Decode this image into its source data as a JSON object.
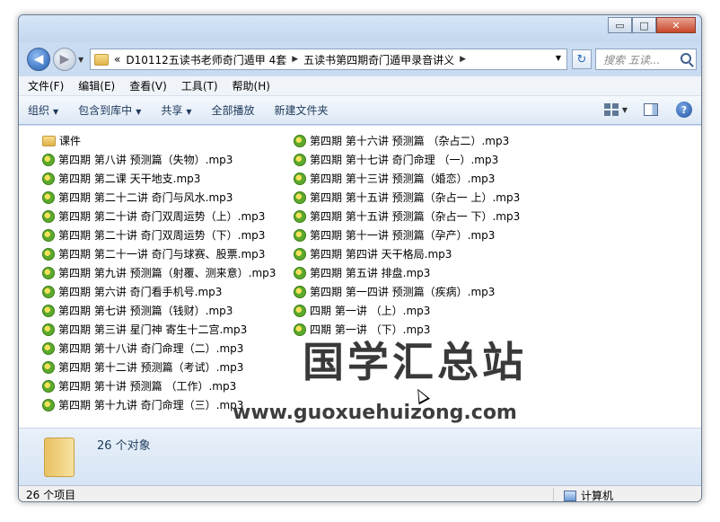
{
  "address": {
    "crumb_root": "«",
    "crumb1": "D10112五读书老师奇门遁甲 4套",
    "crumb2": "五读书第四期奇门遁甲录音讲义",
    "search_placeholder": "搜索 五读..."
  },
  "window": {
    "minimize": "▭",
    "maximize": "□",
    "close": "✕"
  },
  "menu": [
    "文件(F)",
    "编辑(E)",
    "查看(V)",
    "工具(T)",
    "帮助(H)"
  ],
  "toolbar": {
    "organize": "组织",
    "include": "包含到库中",
    "share": "共享",
    "playall": "全部播放",
    "newfolder": "新建文件夹"
  },
  "files_col1": [
    {
      "name": "课件",
      "type": "folder"
    },
    {
      "name": "第四期 第八讲 预测篇（失物）.mp3",
      "type": "mp3"
    },
    {
      "name": "第四期 第二课 天干地支.mp3",
      "type": "mp3"
    },
    {
      "name": "第四期 第二十二讲 奇门与风水.mp3",
      "type": "mp3"
    },
    {
      "name": "第四期 第二十讲 奇门双周运势（上）.mp3",
      "type": "mp3"
    },
    {
      "name": "第四期 第二十讲 奇门双周运势（下）.mp3",
      "type": "mp3"
    },
    {
      "name": "第四期 第二十一讲 奇门与球赛、股票.mp3",
      "type": "mp3"
    },
    {
      "name": "第四期 第九讲 预测篇（射覆、测来意）.mp3",
      "type": "mp3"
    },
    {
      "name": "第四期 第六讲 奇门看手机号.mp3",
      "type": "mp3"
    },
    {
      "name": "第四期 第七讲 预测篇（钱财）.mp3",
      "type": "mp3"
    },
    {
      "name": "第四期 第三讲 星门神 寄生十二宫.mp3",
      "type": "mp3"
    },
    {
      "name": "第四期 第十八讲 奇门命理（二）.mp3",
      "type": "mp3"
    },
    {
      "name": "第四期 第十二讲 预测篇（考试）.mp3",
      "type": "mp3"
    },
    {
      "name": "第四期 第十讲 预测篇 （工作）.mp3",
      "type": "mp3"
    },
    {
      "name": "第四期 第十九讲 奇门命理（三）.mp3",
      "type": "mp3"
    }
  ],
  "files_col2": [
    {
      "name": "第四期 第十六讲 预测篇 （杂占二）.mp3",
      "type": "mp3"
    },
    {
      "name": "第四期 第十七讲 奇门命理 （一）.mp3",
      "type": "mp3"
    },
    {
      "name": "第四期 第十三讲 预测篇（婚恋）.mp3",
      "type": "mp3"
    },
    {
      "name": "第四期 第十五讲 预测篇（杂占一 上）.mp3",
      "type": "mp3"
    },
    {
      "name": "第四期 第十五讲 预测篇（杂占一 下）.mp3",
      "type": "mp3"
    },
    {
      "name": "第四期 第十一讲 预测篇（孕产）.mp3",
      "type": "mp3"
    },
    {
      "name": "第四期 第四讲 天干格局.mp3",
      "type": "mp3"
    },
    {
      "name": "第四期 第五讲 排盘.mp3",
      "type": "mp3"
    },
    {
      "name": "第四期 第一四讲 预测篇（疾病）.mp3",
      "type": "mp3"
    },
    {
      "name": "四期 第一讲 （上）.mp3",
      "type": "mp3"
    },
    {
      "name": "四期 第一讲 （下）.mp3",
      "type": "mp3"
    }
  ],
  "watermark": {
    "title": "国学汇总站",
    "url": "www.guoxuehuizong.com"
  },
  "details": {
    "count": "26 个对象"
  },
  "status": {
    "items": "26 个项目",
    "location": "计算机"
  }
}
